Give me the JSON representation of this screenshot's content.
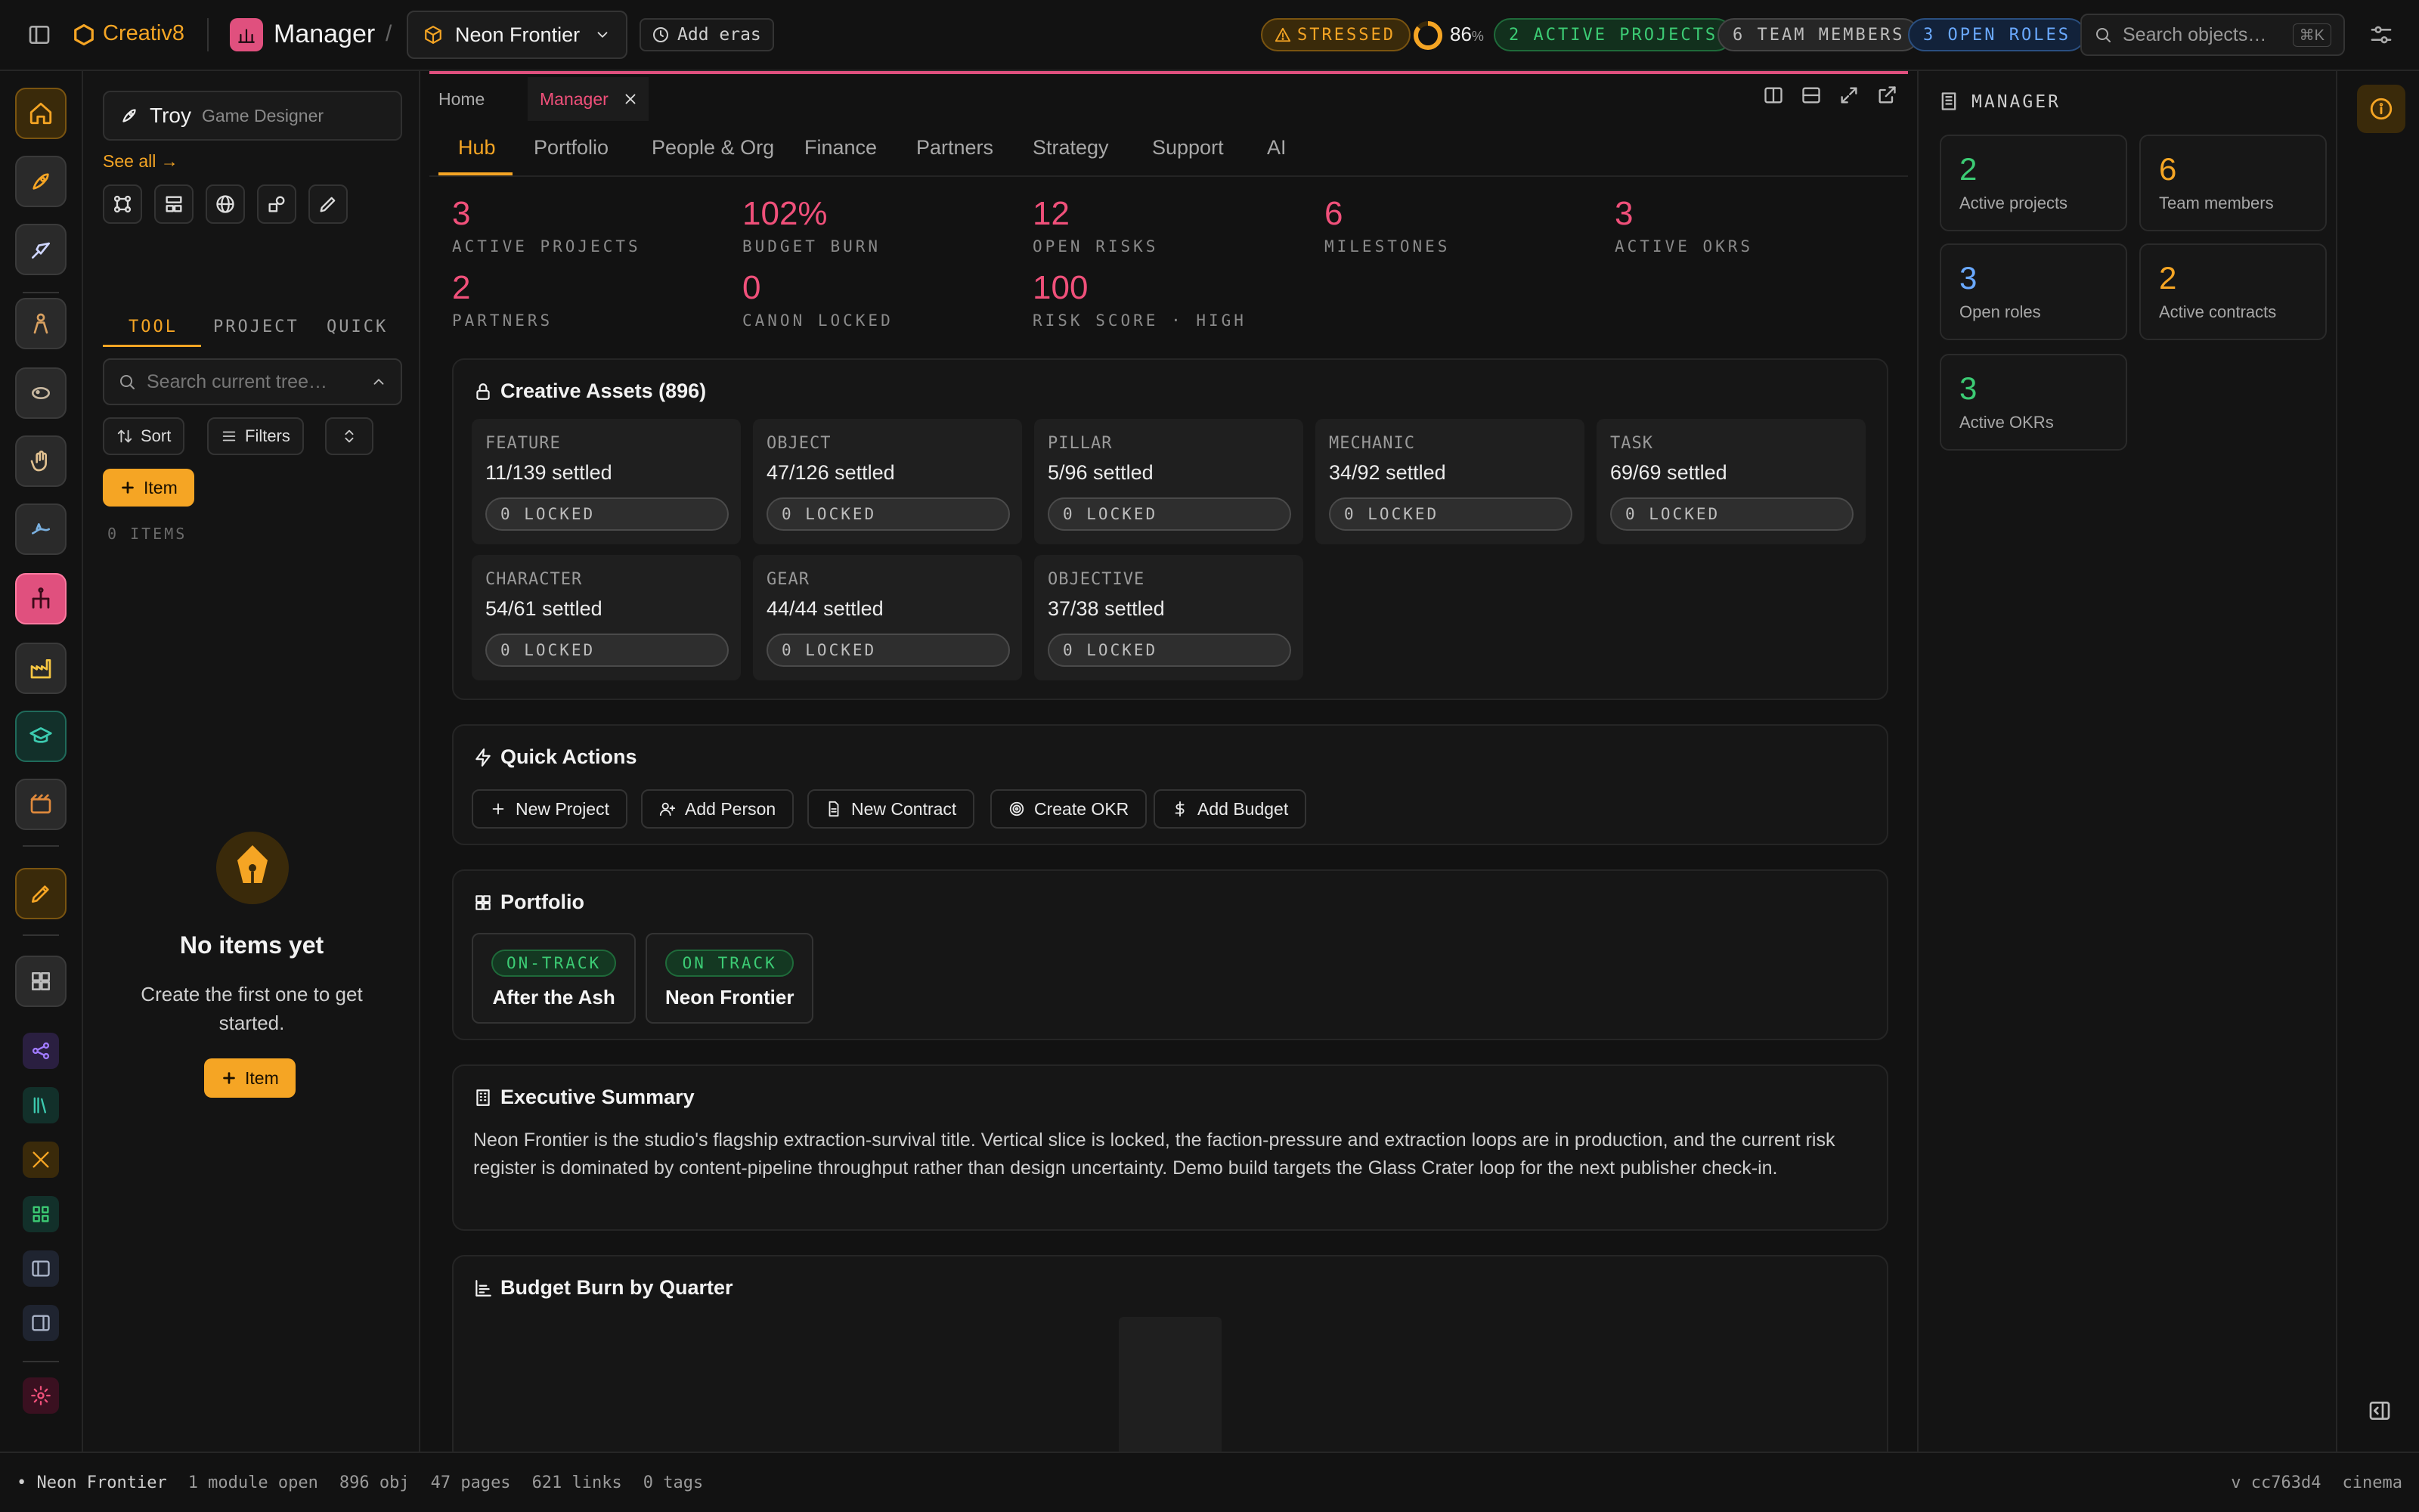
{
  "topbar": {
    "app_name": "Creativ8",
    "module": "Manager",
    "project": "Neon Frontier",
    "add_eras": "Add eras",
    "stressed": "STRESSED",
    "progress_value": "86",
    "progress_unit": "%",
    "progress_fraction": 0.86,
    "active_projects": "2 ACTIVE PROJECTS",
    "team_members": "6 TEAM MEMBERS",
    "open_roles": "3 OPEN ROLES",
    "search_placeholder": "Search objects…",
    "search_shortcut": "⌘K"
  },
  "left": {
    "user_name": "Troy",
    "user_role": "Game Designer",
    "see_all": "See all →",
    "tabs": [
      "TOOL",
      "PROJECT",
      "QUICK"
    ],
    "search_placeholder": "Search current tree…",
    "sort": "Sort",
    "filters": "Filters",
    "add_item": "Item",
    "count": "0 ITEMS",
    "empty_title": "No items yet",
    "empty_line1": "Create the first one to get",
    "empty_line2": "started.",
    "empty_button": "Item"
  },
  "main": {
    "tabs": {
      "home": "Home",
      "manager": "Manager"
    },
    "nav": [
      "Hub",
      "Portfolio",
      "People & Org",
      "Finance",
      "Partners",
      "Strategy",
      "Support",
      "AI"
    ],
    "stats": [
      {
        "value": "3",
        "label": "ACTIVE PROJECTS"
      },
      {
        "value": "102%",
        "label": "BUDGET BURN"
      },
      {
        "value": "12",
        "label": "OPEN RISKS"
      },
      {
        "value": "6",
        "label": "MILESTONES"
      },
      {
        "value": "3",
        "label": "ACTIVE OKRS"
      },
      {
        "value": "2",
        "label": "PARTNERS"
      },
      {
        "value": "0",
        "label": "CANON LOCKED"
      },
      {
        "value": "100",
        "label": "RISK SCORE · HIGH"
      }
    ],
    "assets_title": "Creative Assets (896)",
    "assets": [
      {
        "kind": "FEATURE",
        "settled": "11/139 settled",
        "locked": "0 LOCKED"
      },
      {
        "kind": "OBJECT",
        "settled": "47/126 settled",
        "locked": "0 LOCKED"
      },
      {
        "kind": "PILLAR",
        "settled": "5/96 settled",
        "locked": "0 LOCKED"
      },
      {
        "kind": "MECHANIC",
        "settled": "34/92 settled",
        "locked": "0 LOCKED"
      },
      {
        "kind": "TASK",
        "settled": "69/69 settled",
        "locked": "0 LOCKED"
      },
      {
        "kind": "CHARACTER",
        "settled": "54/61 settled",
        "locked": "0 LOCKED"
      },
      {
        "kind": "GEAR",
        "settled": "44/44 settled",
        "locked": "0 LOCKED"
      },
      {
        "kind": "OBJECTIVE",
        "settled": "37/38 settled",
        "locked": "0 LOCKED"
      }
    ],
    "quick_title": "Quick Actions",
    "quick_actions": [
      "New Project",
      "Add Person",
      "New Contract",
      "Create OKR",
      "Add Budget"
    ],
    "portfolio_title": "Portfolio",
    "portfolio": [
      {
        "status": "ON-TRACK",
        "name": "After the Ash"
      },
      {
        "status": "ON TRACK",
        "name": "Neon Frontier"
      }
    ],
    "exec_title": "Executive Summary",
    "exec_text": "Neon Frontier is the studio's flagship extraction-survival title. Vertical slice is locked, the faction-pressure and extraction loops are in production, and the current risk register is dominated by content-pipeline throughput rather than design uncertainty. Demo build targets the Glass Crater loop for the next publisher check-in.",
    "budget_title": "Budget Burn by Quarter"
  },
  "right": {
    "header": "MANAGER",
    "cards": [
      {
        "value": "2",
        "label": "Active projects",
        "color": "#3ccb74"
      },
      {
        "value": "6",
        "label": "Team members",
        "color": "#f5a524"
      },
      {
        "value": "3",
        "label": "Open roles",
        "color": "#6aa9ff"
      },
      {
        "value": "2",
        "label": "Active contracts",
        "color": "#f5a524"
      },
      {
        "value": "3",
        "label": "Active OKRs",
        "color": "#3ccb74"
      }
    ]
  },
  "status": {
    "project": "Neon Frontier",
    "modules": "1 module open",
    "objects": "896 obj",
    "pages": "47 pages",
    "links": "621 links",
    "tags": "0 tags",
    "version": "v cc763d4",
    "mode": "cinema"
  },
  "colors": {
    "accent": "#f5a524",
    "pink": "#f0507a",
    "green": "#3ccb74",
    "blue": "#6aa9ff"
  }
}
